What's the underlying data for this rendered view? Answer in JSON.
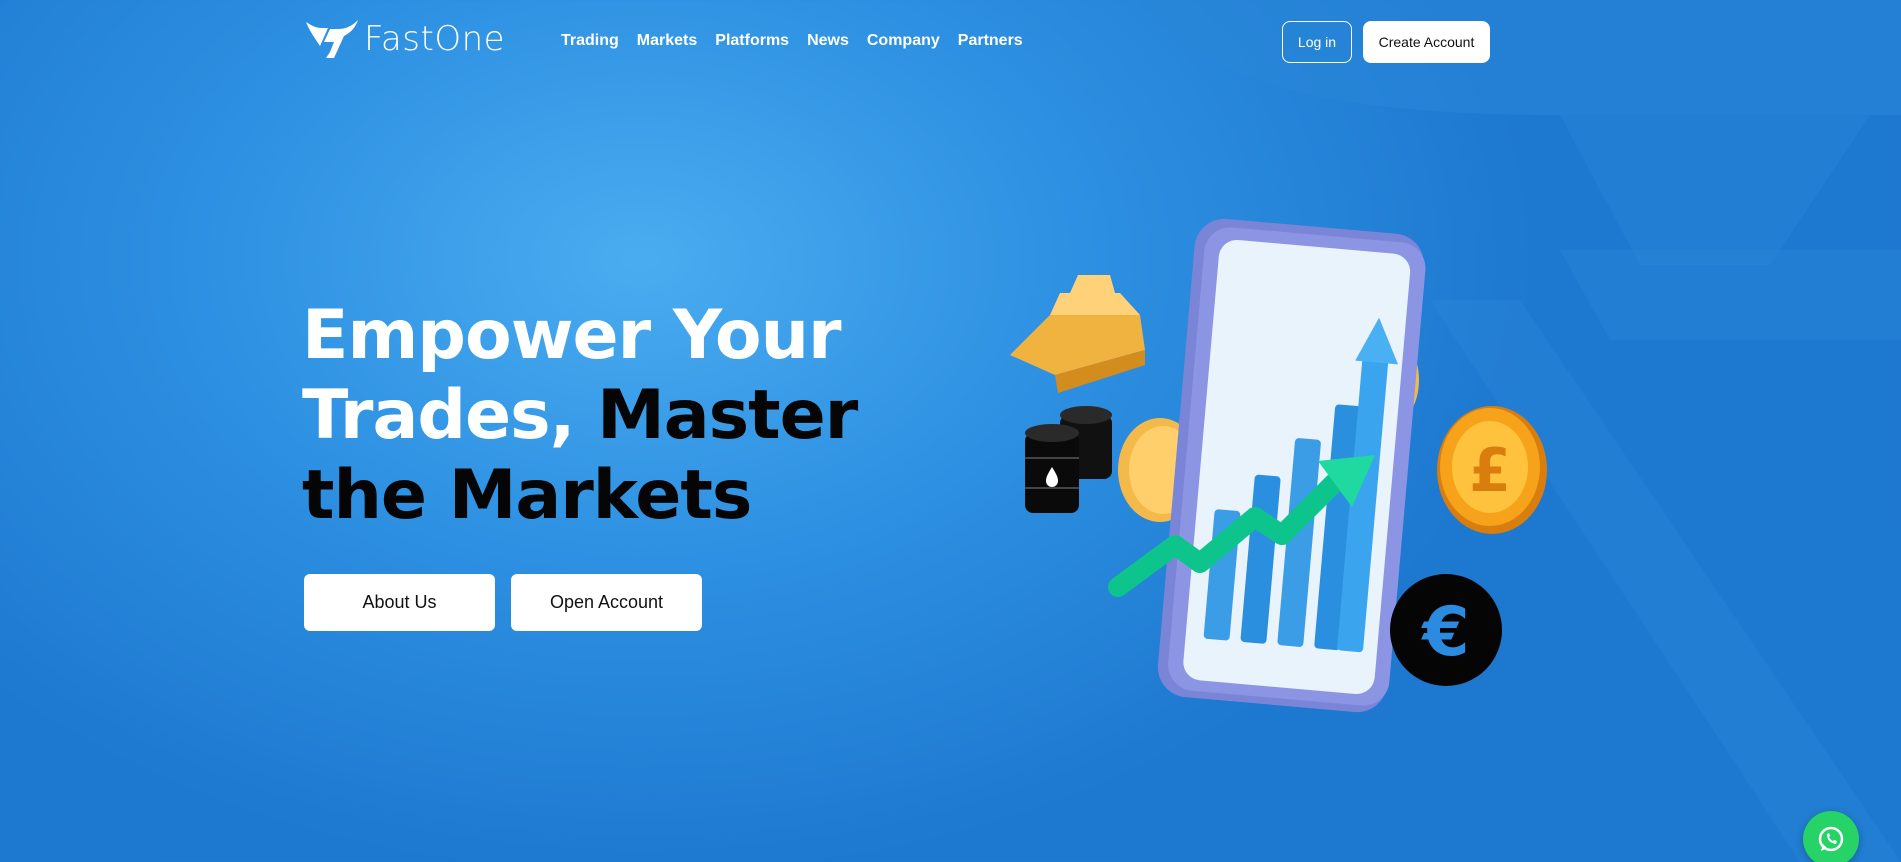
{
  "brand": {
    "name": "FastOne",
    "logo_icon": "bull-horns-logo"
  },
  "nav": {
    "items": [
      {
        "label": "Trading"
      },
      {
        "label": "Markets"
      },
      {
        "label": "Platforms"
      },
      {
        "label": "News"
      },
      {
        "label": "Company"
      },
      {
        "label": "Partners"
      }
    ]
  },
  "header_actions": {
    "login_label": "Log in",
    "create_account_label": "Create Account"
  },
  "hero": {
    "title": {
      "line1": "Empower Your",
      "line2_white": "Trades, ",
      "line2_black": "Master",
      "line3_black_1": "the",
      "line3_black_2": " Markets"
    },
    "buttons": {
      "about_label": "About Us",
      "open_account_label": "Open Account"
    }
  },
  "illustration": {
    "icons": [
      "gold-bar-icon",
      "oil-barrels-icon",
      "pound-coin-icon",
      "euro-coin-icon",
      "phone-growth-chart-icon"
    ],
    "pound_symbol": "£",
    "euro_symbol": "€"
  },
  "floating": {
    "chat_icon": "whatsapp-icon"
  },
  "colors": {
    "background": "#2f92e3",
    "background_light": "#4aacf0",
    "accent_green": "#1fd9a0",
    "coin_gold": "#f6a21a",
    "whatsapp_green": "#25d366"
  }
}
